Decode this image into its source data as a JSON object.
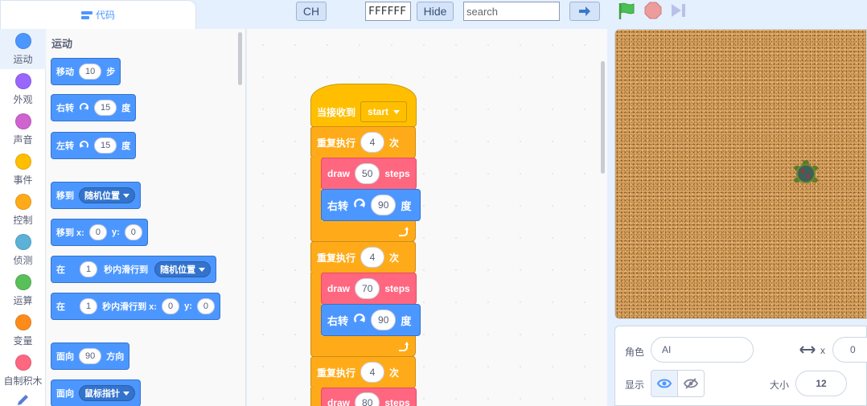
{
  "tabs": {
    "code": "代码"
  },
  "toolbar": {
    "lang_button": "CH",
    "color_value": "FFFFFF",
    "hide_button": "Hide",
    "search_placeholder": "search"
  },
  "categories": [
    {
      "label": "运动",
      "color": "#4c97ff"
    },
    {
      "label": "外观",
      "color": "#9966ff"
    },
    {
      "label": "声音",
      "color": "#cf63cf"
    },
    {
      "label": "事件",
      "color": "#ffbf00"
    },
    {
      "label": "控制",
      "color": "#ffab19"
    },
    {
      "label": "侦测",
      "color": "#5cb1d6"
    },
    {
      "label": "运算",
      "color": "#59c059"
    },
    {
      "label": "变量",
      "color": "#ff8c1a"
    },
    {
      "label": "自制积木",
      "color": "#ff6680"
    }
  ],
  "palette": {
    "title": "运动",
    "move": {
      "label": "移动",
      "value": "10",
      "unit": "步"
    },
    "turn_right": {
      "label": "右转",
      "value": "15",
      "unit": "度"
    },
    "turn_left": {
      "label": "左转",
      "value": "15",
      "unit": "度"
    },
    "goto": {
      "label": "移到",
      "option": "随机位置"
    },
    "goto_xy": {
      "label": "移到 x:",
      "x": "0",
      "ylabel": "y:",
      "y": "0"
    },
    "glide": {
      "pre": "在",
      "secs": "1",
      "mid": "秒内滑行到",
      "option": "随机位置"
    },
    "glide_xy": {
      "pre": "在",
      "secs": "1",
      "mid": "秒内滑行到 x:",
      "x": "0",
      "ylabel": "y:",
      "y": "0"
    },
    "point_dir": {
      "label": "面向",
      "value": "90",
      "unit": "方向"
    },
    "point_towards": {
      "label": "面向",
      "option": "鼠标指针"
    }
  },
  "script": {
    "hat": {
      "label": "当接收到",
      "option": "start"
    },
    "loops": [
      {
        "label": "重复执行",
        "count": "4",
        "unit": "次",
        "draw_label": "draw",
        "draw_value": "50",
        "draw_unit": "steps",
        "turn_label": "右转",
        "turn_value": "90",
        "turn_unit": "度"
      },
      {
        "label": "重复执行",
        "count": "4",
        "unit": "次",
        "draw_label": "draw",
        "draw_value": "70",
        "draw_unit": "steps",
        "turn_label": "右转",
        "turn_value": "90",
        "turn_unit": "度"
      },
      {
        "label": "重复执行",
        "count": "4",
        "unit": "次",
        "draw_label": "draw",
        "draw_value": "80",
        "draw_unit": "steps"
      }
    ]
  },
  "sprite": {
    "name_label": "角色",
    "name_value": "AI",
    "x_label": "x",
    "x_value": "0",
    "show_label": "显示",
    "size_label": "大小",
    "size_value": "12"
  }
}
